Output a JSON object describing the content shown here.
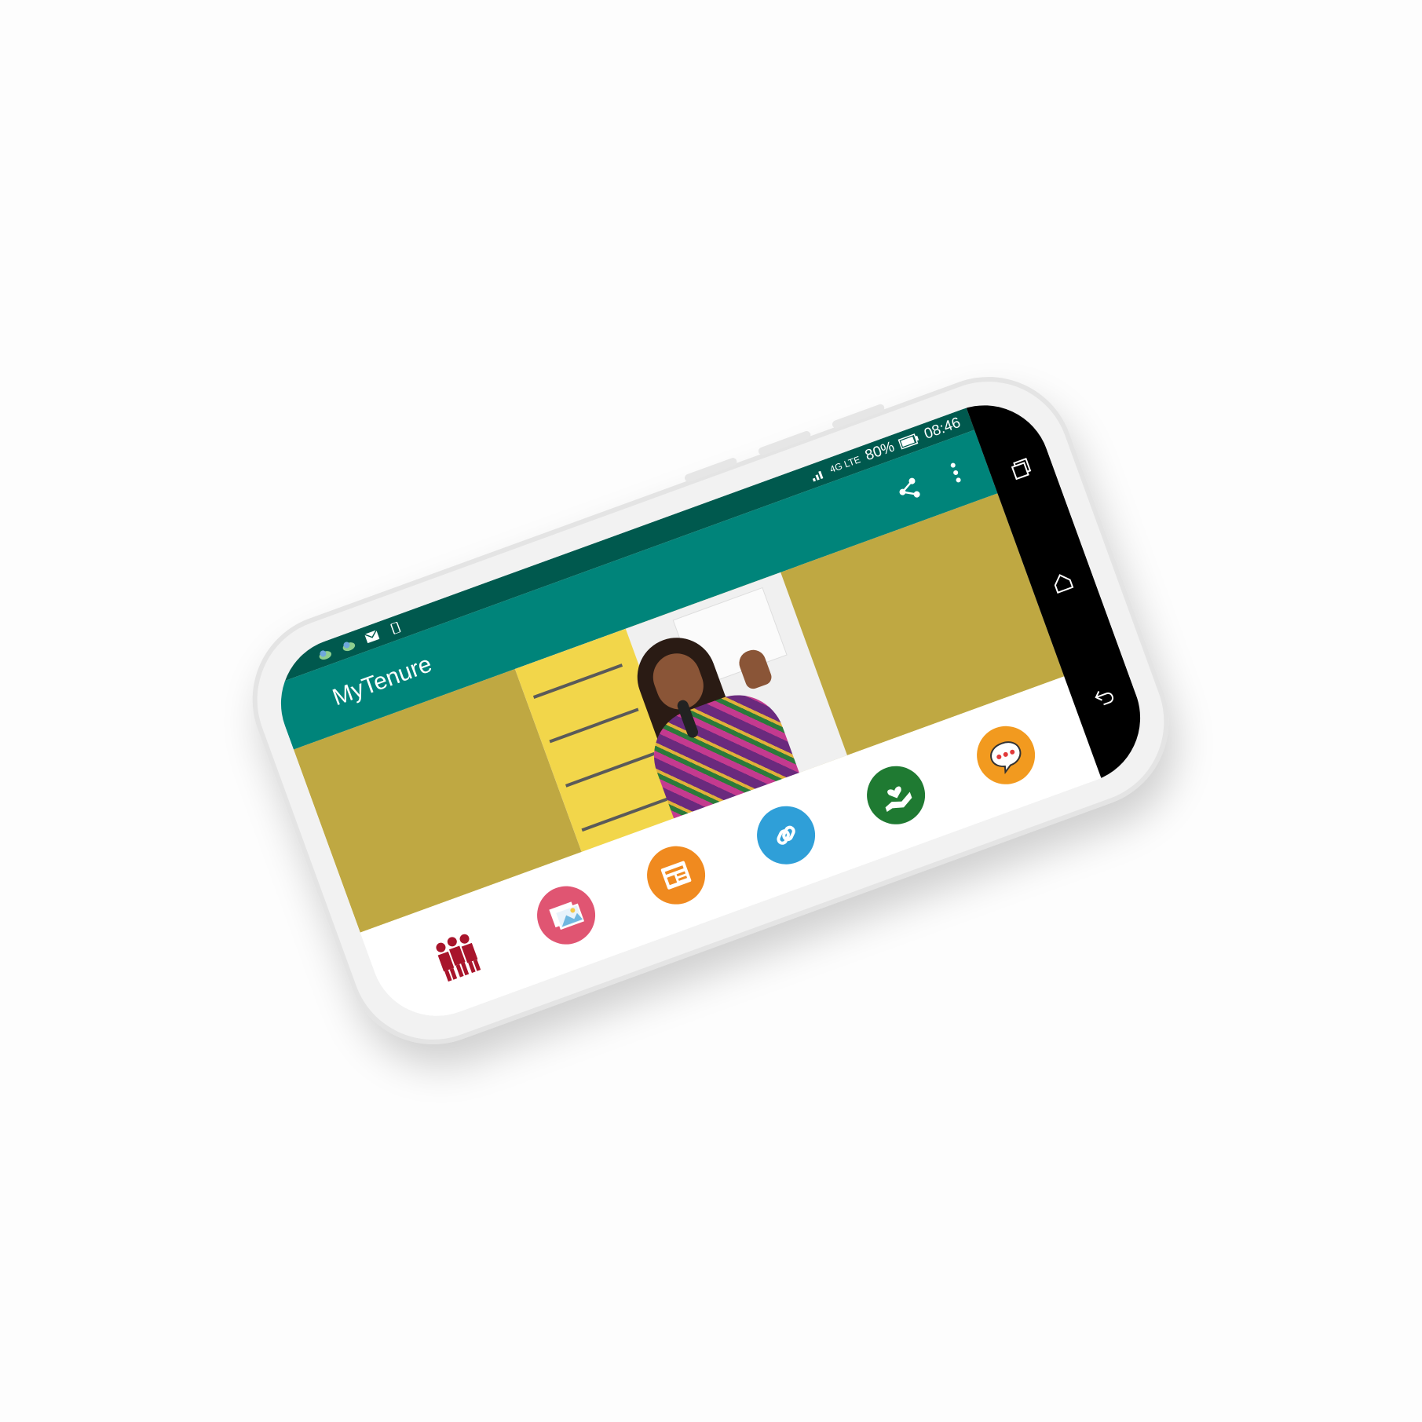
{
  "status_bar": {
    "time": "08:46",
    "battery": "80%",
    "network": "4G LTE",
    "left_icons": [
      "cloud-icon",
      "cloud-icon",
      "mail-icon",
      "phone-vibrate-icon"
    ]
  },
  "app_bar": {
    "title": "MyTenure",
    "actions": [
      "share-icon",
      "more-vert-icon"
    ]
  },
  "banner": {
    "background_color": "#bfa842",
    "image": "speaker-with-microphone-photo"
  },
  "menu": {
    "items": [
      {
        "icon": "people-group-icon",
        "color": "#a8142b"
      },
      {
        "icon": "gallery-icon",
        "color": "#e05572"
      },
      {
        "icon": "news-icon",
        "color": "#f08a1f"
      },
      {
        "icon": "link-icon",
        "color": "#2f9fd8"
      },
      {
        "icon": "care-hand-icon",
        "color": "#1f7a32"
      },
      {
        "icon": "chat-bubble-icon",
        "color": "#f29a1f"
      }
    ]
  },
  "colors": {
    "status_bar": "#00594e",
    "app_bar": "#00847a",
    "nav_bar": "#000000"
  }
}
